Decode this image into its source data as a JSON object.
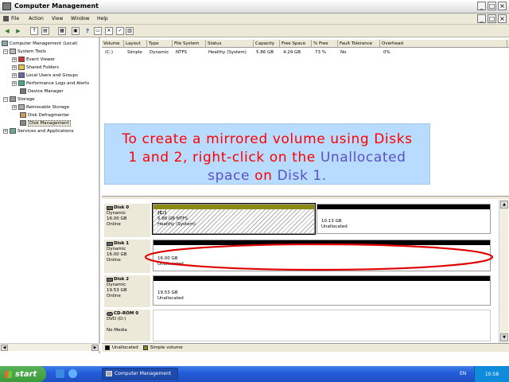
{
  "window": {
    "title": "Computer Management"
  },
  "menu": [
    "File",
    "Action",
    "View",
    "Window",
    "Help"
  ],
  "toolbar_icons": [
    "back-icon",
    "forward-icon",
    "up-icon",
    "show-hide-tree-icon",
    "export-icon",
    "properties-icon",
    "help-icon",
    "refresh-icon",
    "copy-icon",
    "paste-icon",
    "view-icon"
  ],
  "tree": {
    "root": "Computer Management (Local)",
    "system_tools": "System Tools",
    "event_viewer": "Event Viewer",
    "shared_folders": "Shared Folders",
    "local_users": "Local Users and Groups",
    "perf_logs": "Performance Logs and Alerts",
    "device_manager": "Device Manager",
    "storage": "Storage",
    "removable_storage": "Removable Storage",
    "disk_defrag": "Disk Defragmenter",
    "disk_mgmt": "Disk Management",
    "services": "Services and Applications"
  },
  "volume_list": {
    "columns": [
      "Volume",
      "Layout",
      "Type",
      "File System",
      "Status",
      "Capacity",
      "Free Space",
      "% Free",
      "Fault Tolerance",
      "Overhead"
    ],
    "rows": [
      [
        "(C:)",
        "Simple",
        "Dynamic",
        "NTFS",
        "Healthy (System)",
        "5.86 GB",
        "4.29 GB",
        "73 %",
        "No",
        "0%"
      ]
    ]
  },
  "instruction": {
    "line1": "To create a mirrored volume using Disks",
    "line2": "1 and 2, right-click on the",
    "line2_highlight": "Unallocated",
    "line3_highlight": "space",
    "line3_mid": "on",
    "line3_end": "Disk 1."
  },
  "disks": [
    {
      "name": "Disk 0",
      "type": "Dynamic",
      "size": "16.00 GB",
      "status": "Online",
      "partitions": [
        {
          "label": "(C:)",
          "detail": "5.86 GB NTFS",
          "status": "Healthy (System)"
        },
        {
          "label": "",
          "detail": "10.13 GB",
          "status": "Unallocated"
        }
      ]
    },
    {
      "name": "Disk 1",
      "type": "Dynamic",
      "size": "16.00 GB",
      "status": "Online",
      "partitions": [
        {
          "label": "",
          "detail": "16.00 GB",
          "status": "Unallocated"
        }
      ]
    },
    {
      "name": "Disk 2",
      "type": "Dynamic",
      "size": "19.53 GB",
      "status": "Online",
      "partitions": [
        {
          "label": "",
          "detail": "19.53 GB",
          "status": "Unallocated"
        }
      ]
    },
    {
      "name": "CD-ROM 0",
      "type": "DVD (D:)",
      "size": "",
      "status": "No Media",
      "partitions": []
    }
  ],
  "legend": {
    "unallocated": "Unallocated",
    "simple": "Simple volume"
  },
  "taskbar": {
    "start": "start",
    "task": "Computer Management",
    "lang": "EN",
    "clock": "10:58"
  },
  "colors": {
    "simple_volume": "#8a8a14",
    "unallocated": "#000000",
    "highlight_ellipse": "#e00000",
    "callout_bg": "#b8dcff",
    "callout_text": "#ff0000",
    "callout_highlight": "#5b50c8"
  }
}
